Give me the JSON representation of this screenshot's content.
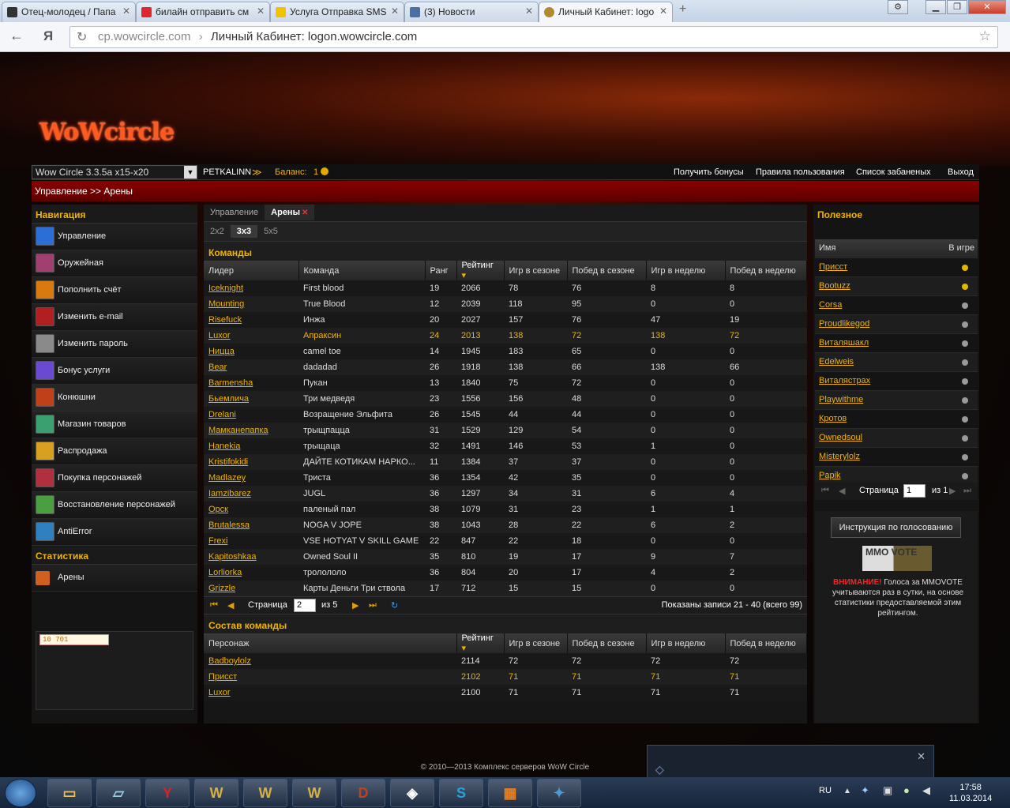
{
  "browser": {
    "tabs": [
      {
        "label": "Отец-молодец / Папа",
        "icon_color": "#333333"
      },
      {
        "label": "билайн отправить см",
        "icon_color": "#e0262e"
      },
      {
        "label": "Услуга Отправка SMS",
        "icon_color": "#f2c200"
      },
      {
        "label": "(3) Новости",
        "icon_color": "#4a6fa5"
      },
      {
        "label": "Личный Кабинет: logo",
        "icon_color": "#b08a30"
      }
    ],
    "new_tab": "+",
    "url_domain": "cp.wowcircle.com",
    "url_title": "Личный Кабинет: logon.wowcircle.com"
  },
  "site": {
    "logo": "WoWcircle",
    "realm": "Wow Circle 3.3.5a x15-x20",
    "username": "PETKALINN",
    "balance_label": "Баланс:",
    "balance_value": "1",
    "top_links": [
      "Получить бонусы",
      "Правила пользования",
      "Список забаненых",
      "Выход"
    ],
    "breadcrumb": "Управление >> Арены"
  },
  "nav": {
    "title": "Навигация",
    "items": [
      {
        "label": "Управление",
        "icon": "gear-icon",
        "color": "#2b6fd6"
      },
      {
        "label": "Оружейная",
        "icon": "armory-icon",
        "color": "#a04070"
      },
      {
        "label": "Пополнить счёт",
        "icon": "coin-icon",
        "color": "#d87a10"
      },
      {
        "label": "Изменить e-mail",
        "icon": "mail-icon",
        "color": "#b02020"
      },
      {
        "label": "Изменить пароль",
        "icon": "key-icon",
        "color": "#8a8a8a"
      },
      {
        "label": "Бонус услуги",
        "icon": "bonus-icon",
        "color": "#6a4ad0"
      },
      {
        "label": "Конюшни",
        "icon": "horse-icon",
        "color": "#c0401a"
      },
      {
        "label": "Магазин товаров",
        "icon": "shop-icon",
        "color": "#3aa070"
      },
      {
        "label": "Распродажа",
        "icon": "sale-icon",
        "color": "#d8a020"
      },
      {
        "label": "Покупка персонажей",
        "icon": "character-icon",
        "color": "#b03040"
      },
      {
        "label": "Восстановление персонажей",
        "icon": "restore-icon",
        "color": "#4aa040"
      },
      {
        "label": "AntiError",
        "icon": "antierror-icon",
        "color": "#3080c0"
      }
    ],
    "stats_title": "Статистика",
    "stats_items": [
      {
        "label": "Арены",
        "icon": "arena-icon",
        "color": "#d06020"
      }
    ],
    "counter": "10 701"
  },
  "main": {
    "tabs": [
      {
        "label": "Управление"
      },
      {
        "label": "Арены"
      }
    ],
    "close_glyph": "✕",
    "sub_tabs": [
      "2x2",
      "3x3",
      "5x5"
    ],
    "teams": {
      "title": "Команды",
      "columns": [
        "Лидер",
        "Команда",
        "Ранг",
        "Рейтинг",
        "Игр в сезоне",
        "Побед в сезоне",
        "Игр в неделю",
        "Побед в неделю"
      ],
      "rows": [
        [
          "Iceknight",
          "First blood",
          "19",
          "2066",
          "78",
          "76",
          "8",
          "8"
        ],
        [
          "Mounting",
          "True Blood",
          "12",
          "2039",
          "118",
          "95",
          "0",
          "0"
        ],
        [
          "Risefuck",
          "Инжа",
          "20",
          "2027",
          "157",
          "76",
          "47",
          "19"
        ],
        [
          "Luxor",
          "Апраксин",
          "24",
          "2013",
          "138",
          "72",
          "138",
          "72"
        ],
        [
          "Ницца",
          "camel toe",
          "14",
          "1945",
          "183",
          "65",
          "0",
          "0"
        ],
        [
          "Bear",
          "dadadad",
          "26",
          "1918",
          "138",
          "66",
          "138",
          "66"
        ],
        [
          "Barmensha",
          "Пукан",
          "13",
          "1840",
          "75",
          "72",
          "0",
          "0"
        ],
        [
          "Бьемлича",
          "Три медведя",
          "23",
          "1556",
          "156",
          "48",
          "0",
          "0"
        ],
        [
          "Drelani",
          "Возращение Эльфита",
          "26",
          "1545",
          "44",
          "44",
          "0",
          "0"
        ],
        [
          "Мамканепапка",
          "трыщпацца",
          "31",
          "1529",
          "129",
          "54",
          "0",
          "0"
        ],
        [
          "Hanekia",
          "трыщаца",
          "32",
          "1491",
          "146",
          "53",
          "1",
          "0"
        ],
        [
          "Kristifokidi",
          "ДАЙТЕ КОТИКАМ НАРКО...",
          "11",
          "1384",
          "37",
          "37",
          "0",
          "0"
        ],
        [
          "Madlazey",
          "Триста",
          "36",
          "1354",
          "42",
          "35",
          "0",
          "0"
        ],
        [
          "Iamzibarez",
          "JUGL",
          "36",
          "1297",
          "34",
          "31",
          "6",
          "4"
        ],
        [
          "Орск",
          "паленый пал",
          "38",
          "1079",
          "31",
          "23",
          "1",
          "1"
        ],
        [
          "Brutalessa",
          "NOGA V JOPE",
          "38",
          "1043",
          "28",
          "22",
          "6",
          "2"
        ],
        [
          "Frexi",
          "VSE HOTYAT V SKILL GAME",
          "22",
          "847",
          "22",
          "18",
          "0",
          "0"
        ],
        [
          "Kapitoshkaa",
          "Owned Soul II",
          "35",
          "810",
          "19",
          "17",
          "9",
          "7"
        ],
        [
          "Lorliorka",
          "тролололо",
          "36",
          "804",
          "20",
          "17",
          "4",
          "2"
        ],
        [
          "Grizzle",
          "Карты Деньги Три ствола",
          "17",
          "712",
          "15",
          "15",
          "0",
          "0"
        ]
      ],
      "highlight_row": 3,
      "pager": {
        "page_label": "Страница",
        "page": "2",
        "of": "из 5",
        "summary": "Показаны записи 21 - 40 (всего 99)"
      }
    },
    "roster": {
      "title": "Состав команды",
      "columns": [
        "Персонаж",
        "Рейтинг",
        "Игр в сезоне",
        "Побед в сезоне",
        "Игр в неделю",
        "Побед в неделю"
      ],
      "rows": [
        [
          "Badboylolz",
          "2114",
          "72",
          "72",
          "72",
          "72"
        ],
        [
          "Присст",
          "2102",
          "71",
          "71",
          "71",
          "71"
        ],
        [
          "Luxor",
          "2100",
          "71",
          "71",
          "71",
          "71"
        ]
      ],
      "highlight_row": 1
    }
  },
  "useful": {
    "title": "Полезное",
    "col_name": "Имя",
    "col_online": "В игре",
    "players": [
      {
        "name": "Присст",
        "online": true
      },
      {
        "name": "Bootuzz",
        "online": true
      },
      {
        "name": "Corsa",
        "online": false
      },
      {
        "name": "Proudlikegod",
        "online": false
      },
      {
        "name": "Виталяшакл",
        "online": false
      },
      {
        "name": "Edelweis",
        "online": false
      },
      {
        "name": "Виталястрах",
        "online": false
      },
      {
        "name": "Playwithme",
        "online": false
      },
      {
        "name": "Кротов",
        "online": false
      },
      {
        "name": "Ownedsoul",
        "online": false
      },
      {
        "name": "Misterylolz",
        "online": false
      },
      {
        "name": "Papik",
        "online": false
      }
    ],
    "online_color": "#e0b800",
    "offline_color": "#9a9a9a",
    "pager": {
      "page_label": "Страница",
      "page": "1",
      "of": "из 1"
    },
    "vote_button": "Инструкция по голосованию",
    "vote_logo": "MMO VOTE",
    "vote_warning": "ВНИМАНИЕ!",
    "vote_text": "Голоса за MMOVOTE учитываются раз в сутки, на основе статистики предоставляемой этим рейтингом."
  },
  "footer": "© 2010—2013 Комплекс серверов WoW Circle",
  "taskbar": {
    "lang": "RU",
    "time": "17:58",
    "date": "11.03.2014"
  }
}
